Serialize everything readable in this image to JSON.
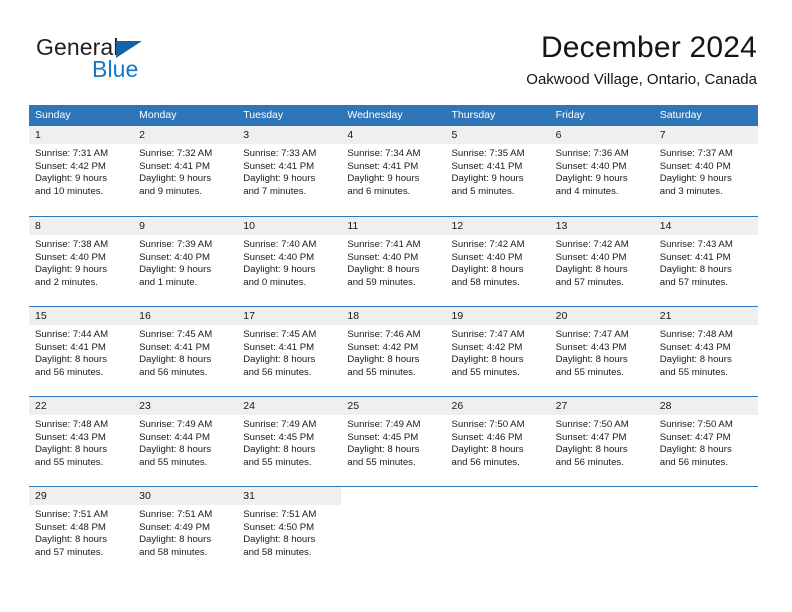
{
  "brand": {
    "name_part1": "General",
    "name_part2": "Blue",
    "triangle_color": "#1464a5",
    "blue_color": "#1477c8"
  },
  "header": {
    "month_title": "December 2024",
    "location": "Oakwood Village, Ontario, Canada"
  },
  "theme": {
    "header_row_bg": "#2e76b8",
    "day_number_bg": "#efefef",
    "row_divider": "#2e76b8",
    "text": "#1a1a1a"
  },
  "weekdays": [
    "Sunday",
    "Monday",
    "Tuesday",
    "Wednesday",
    "Thursday",
    "Friday",
    "Saturday"
  ],
  "weeks": [
    [
      {
        "day": "1",
        "sunrise": "Sunrise: 7:31 AM",
        "sunset": "Sunset: 4:42 PM",
        "daylight1": "Daylight: 9 hours",
        "daylight2": "and 10 minutes."
      },
      {
        "day": "2",
        "sunrise": "Sunrise: 7:32 AM",
        "sunset": "Sunset: 4:41 PM",
        "daylight1": "Daylight: 9 hours",
        "daylight2": "and 9 minutes."
      },
      {
        "day": "3",
        "sunrise": "Sunrise: 7:33 AM",
        "sunset": "Sunset: 4:41 PM",
        "daylight1": "Daylight: 9 hours",
        "daylight2": "and 7 minutes."
      },
      {
        "day": "4",
        "sunrise": "Sunrise: 7:34 AM",
        "sunset": "Sunset: 4:41 PM",
        "daylight1": "Daylight: 9 hours",
        "daylight2": "and 6 minutes."
      },
      {
        "day": "5",
        "sunrise": "Sunrise: 7:35 AM",
        "sunset": "Sunset: 4:41 PM",
        "daylight1": "Daylight: 9 hours",
        "daylight2": "and 5 minutes."
      },
      {
        "day": "6",
        "sunrise": "Sunrise: 7:36 AM",
        "sunset": "Sunset: 4:40 PM",
        "daylight1": "Daylight: 9 hours",
        "daylight2": "and 4 minutes."
      },
      {
        "day": "7",
        "sunrise": "Sunrise: 7:37 AM",
        "sunset": "Sunset: 4:40 PM",
        "daylight1": "Daylight: 9 hours",
        "daylight2": "and 3 minutes."
      }
    ],
    [
      {
        "day": "8",
        "sunrise": "Sunrise: 7:38 AM",
        "sunset": "Sunset: 4:40 PM",
        "daylight1": "Daylight: 9 hours",
        "daylight2": "and 2 minutes."
      },
      {
        "day": "9",
        "sunrise": "Sunrise: 7:39 AM",
        "sunset": "Sunset: 4:40 PM",
        "daylight1": "Daylight: 9 hours",
        "daylight2": "and 1 minute."
      },
      {
        "day": "10",
        "sunrise": "Sunrise: 7:40 AM",
        "sunset": "Sunset: 4:40 PM",
        "daylight1": "Daylight: 9 hours",
        "daylight2": "and 0 minutes."
      },
      {
        "day": "11",
        "sunrise": "Sunrise: 7:41 AM",
        "sunset": "Sunset: 4:40 PM",
        "daylight1": "Daylight: 8 hours",
        "daylight2": "and 59 minutes."
      },
      {
        "day": "12",
        "sunrise": "Sunrise: 7:42 AM",
        "sunset": "Sunset: 4:40 PM",
        "daylight1": "Daylight: 8 hours",
        "daylight2": "and 58 minutes."
      },
      {
        "day": "13",
        "sunrise": "Sunrise: 7:42 AM",
        "sunset": "Sunset: 4:40 PM",
        "daylight1": "Daylight: 8 hours",
        "daylight2": "and 57 minutes."
      },
      {
        "day": "14",
        "sunrise": "Sunrise: 7:43 AM",
        "sunset": "Sunset: 4:41 PM",
        "daylight1": "Daylight: 8 hours",
        "daylight2": "and 57 minutes."
      }
    ],
    [
      {
        "day": "15",
        "sunrise": "Sunrise: 7:44 AM",
        "sunset": "Sunset: 4:41 PM",
        "daylight1": "Daylight: 8 hours",
        "daylight2": "and 56 minutes."
      },
      {
        "day": "16",
        "sunrise": "Sunrise: 7:45 AM",
        "sunset": "Sunset: 4:41 PM",
        "daylight1": "Daylight: 8 hours",
        "daylight2": "and 56 minutes."
      },
      {
        "day": "17",
        "sunrise": "Sunrise: 7:45 AM",
        "sunset": "Sunset: 4:41 PM",
        "daylight1": "Daylight: 8 hours",
        "daylight2": "and 56 minutes."
      },
      {
        "day": "18",
        "sunrise": "Sunrise: 7:46 AM",
        "sunset": "Sunset: 4:42 PM",
        "daylight1": "Daylight: 8 hours",
        "daylight2": "and 55 minutes."
      },
      {
        "day": "19",
        "sunrise": "Sunrise: 7:47 AM",
        "sunset": "Sunset: 4:42 PM",
        "daylight1": "Daylight: 8 hours",
        "daylight2": "and 55 minutes."
      },
      {
        "day": "20",
        "sunrise": "Sunrise: 7:47 AM",
        "sunset": "Sunset: 4:43 PM",
        "daylight1": "Daylight: 8 hours",
        "daylight2": "and 55 minutes."
      },
      {
        "day": "21",
        "sunrise": "Sunrise: 7:48 AM",
        "sunset": "Sunset: 4:43 PM",
        "daylight1": "Daylight: 8 hours",
        "daylight2": "and 55 minutes."
      }
    ],
    [
      {
        "day": "22",
        "sunrise": "Sunrise: 7:48 AM",
        "sunset": "Sunset: 4:43 PM",
        "daylight1": "Daylight: 8 hours",
        "daylight2": "and 55 minutes."
      },
      {
        "day": "23",
        "sunrise": "Sunrise: 7:49 AM",
        "sunset": "Sunset: 4:44 PM",
        "daylight1": "Daylight: 8 hours",
        "daylight2": "and 55 minutes."
      },
      {
        "day": "24",
        "sunrise": "Sunrise: 7:49 AM",
        "sunset": "Sunset: 4:45 PM",
        "daylight1": "Daylight: 8 hours",
        "daylight2": "and 55 minutes."
      },
      {
        "day": "25",
        "sunrise": "Sunrise: 7:49 AM",
        "sunset": "Sunset: 4:45 PM",
        "daylight1": "Daylight: 8 hours",
        "daylight2": "and 55 minutes."
      },
      {
        "day": "26",
        "sunrise": "Sunrise: 7:50 AM",
        "sunset": "Sunset: 4:46 PM",
        "daylight1": "Daylight: 8 hours",
        "daylight2": "and 56 minutes."
      },
      {
        "day": "27",
        "sunrise": "Sunrise: 7:50 AM",
        "sunset": "Sunset: 4:47 PM",
        "daylight1": "Daylight: 8 hours",
        "daylight2": "and 56 minutes."
      },
      {
        "day": "28",
        "sunrise": "Sunrise: 7:50 AM",
        "sunset": "Sunset: 4:47 PM",
        "daylight1": "Daylight: 8 hours",
        "daylight2": "and 56 minutes."
      }
    ],
    [
      {
        "day": "29",
        "sunrise": "Sunrise: 7:51 AM",
        "sunset": "Sunset: 4:48 PM",
        "daylight1": "Daylight: 8 hours",
        "daylight2": "and 57 minutes."
      },
      {
        "day": "30",
        "sunrise": "Sunrise: 7:51 AM",
        "sunset": "Sunset: 4:49 PM",
        "daylight1": "Daylight: 8 hours",
        "daylight2": "and 58 minutes."
      },
      {
        "day": "31",
        "sunrise": "Sunrise: 7:51 AM",
        "sunset": "Sunset: 4:50 PM",
        "daylight1": "Daylight: 8 hours",
        "daylight2": "and 58 minutes."
      },
      {
        "day": "",
        "sunrise": "",
        "sunset": "",
        "daylight1": "",
        "daylight2": ""
      },
      {
        "day": "",
        "sunrise": "",
        "sunset": "",
        "daylight1": "",
        "daylight2": ""
      },
      {
        "day": "",
        "sunrise": "",
        "sunset": "",
        "daylight1": "",
        "daylight2": ""
      },
      {
        "day": "",
        "sunrise": "",
        "sunset": "",
        "daylight1": "",
        "daylight2": ""
      }
    ]
  ]
}
